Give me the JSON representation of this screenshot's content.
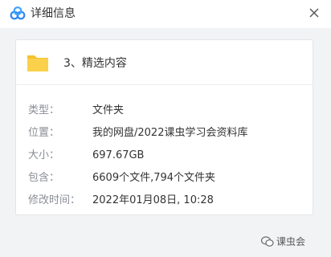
{
  "window": {
    "title": "详细信息",
    "logo_icon": "baidu-netdisk-logo-icon",
    "close_icon": "close-icon"
  },
  "file": {
    "name": "3、精选内容",
    "icon": "folder-icon"
  },
  "details": [
    {
      "label": "类型：",
      "value": "文件夹"
    },
    {
      "label": "位置：",
      "value": "我的网盘/2022课虫学习会资料库"
    },
    {
      "label": "大小：",
      "value": "697.67GB"
    },
    {
      "label": "包含：",
      "value": "6609个文件,794个文件夹"
    },
    {
      "label": "修改时间：",
      "value": "2022年01月08日, 10:28"
    }
  ],
  "watermark": {
    "text": "课虫会",
    "icon": "wechat-icon"
  },
  "colors": {
    "folder": "#f6c230",
    "logo_blue": "#2f87f5",
    "background": "#f2f3f5"
  }
}
